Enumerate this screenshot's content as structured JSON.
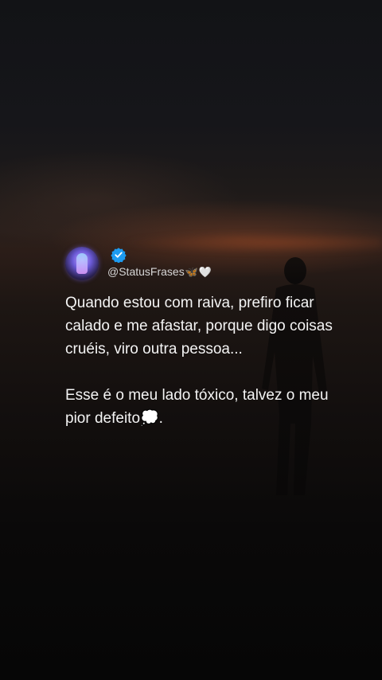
{
  "post": {
    "handle": "@StatusFrases",
    "handle_icons": [
      "butterfly-icon",
      "heart-icon"
    ],
    "butterfly": "🦋",
    "heart": "🤍",
    "verified": true,
    "paragraphs": [
      "Quando estou com raiva, prefiro ficar calado e me afastar, porque digo coisas cruéis, viro outra pessoa...",
      "Esse é o meu lado tóxico, talvez o meu pior defeito💭."
    ]
  },
  "colors": {
    "text": "#f4f4f4",
    "handle": "#d6d6d6",
    "verified": "#1d9bf0"
  }
}
